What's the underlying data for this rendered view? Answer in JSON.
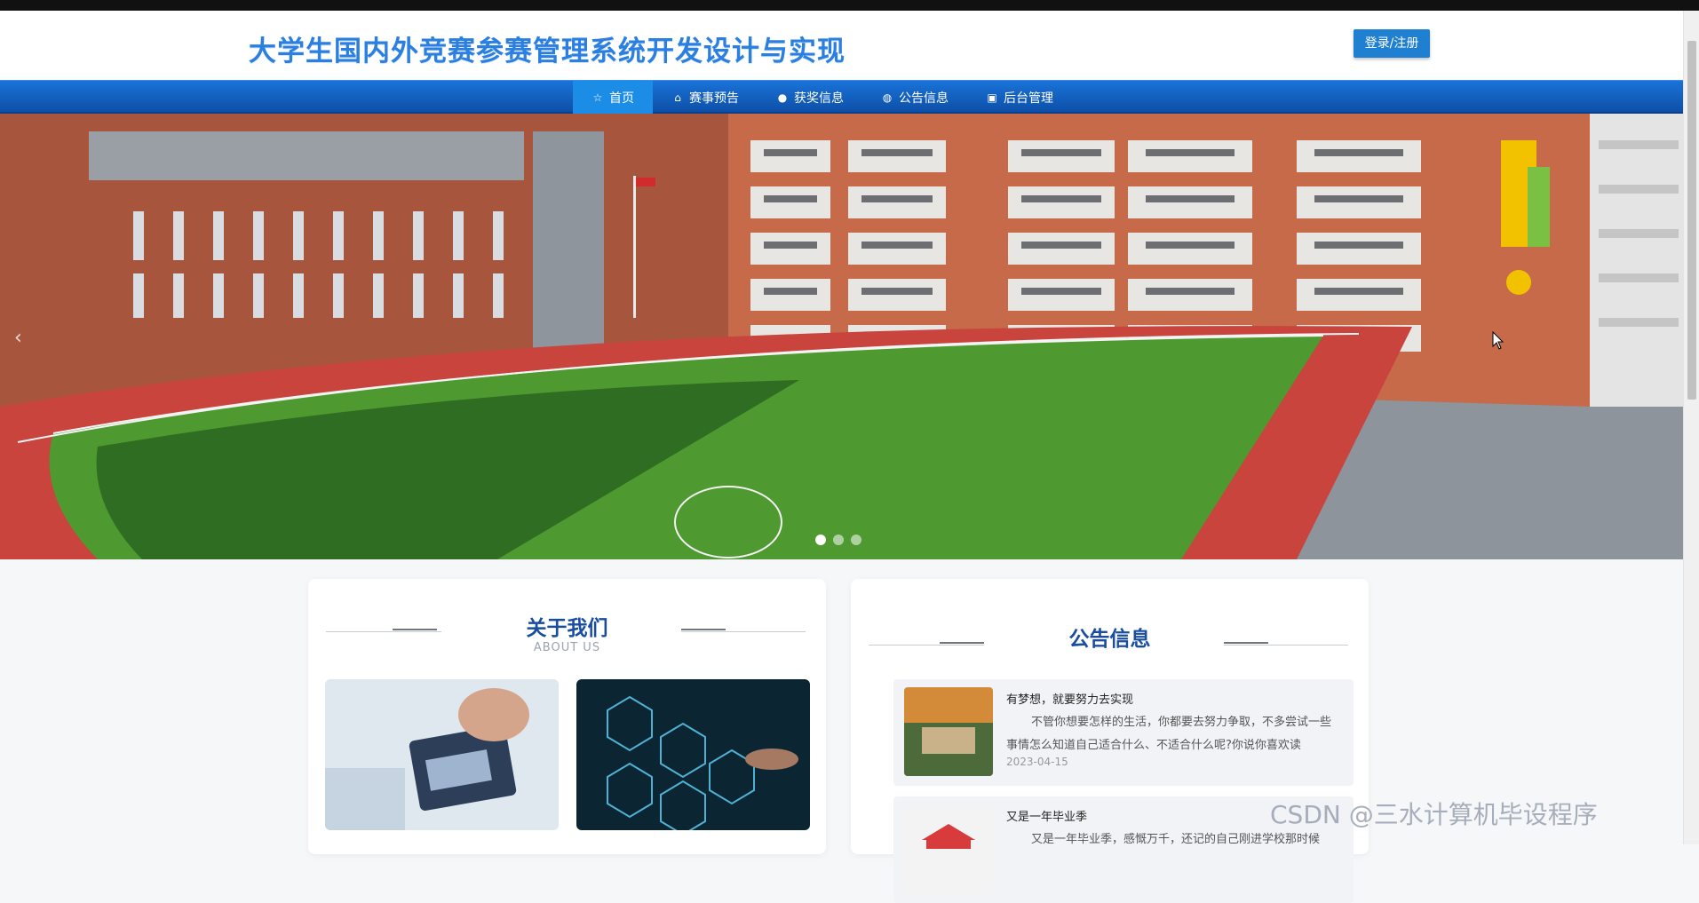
{
  "header": {
    "site_title": "大学生国内外竞赛参赛管理系统开发设计与实现",
    "login_button": "登录/注册"
  },
  "nav": {
    "items": [
      {
        "label": "首页",
        "icon": "star-icon"
      },
      {
        "label": "赛事预告",
        "icon": "home-icon"
      },
      {
        "label": "获奖信息",
        "icon": "info-circle-icon"
      },
      {
        "label": "公告信息",
        "icon": "globe-icon"
      },
      {
        "label": "后台管理",
        "icon": "gift-icon"
      }
    ],
    "active_index": 0
  },
  "banner": {
    "slide_count": 3,
    "active_slide": 0
  },
  "about": {
    "title": "关于我们",
    "subtitle": "ABOUT US"
  },
  "notice": {
    "title": "公告信息",
    "items": [
      {
        "title": "有梦想，就要努力去实现",
        "body": "不管你想要怎样的生活，你都要去努力争取，不多尝试一些事情怎么知道自己适合什么、不适合什么呢?你说你喜欢读",
        "date": "2023-04-15"
      },
      {
        "title": "又是一年毕业季",
        "body": "又是一年毕业季，感慨万千，还记的自己刚进学校那时候",
        "date": ""
      }
    ]
  },
  "watermark": "CSDN @三水计算机毕设程序",
  "colors": {
    "nav_bg": "#0d4fa8",
    "accent": "#2b7fe1",
    "section_title": "#184d9f"
  }
}
